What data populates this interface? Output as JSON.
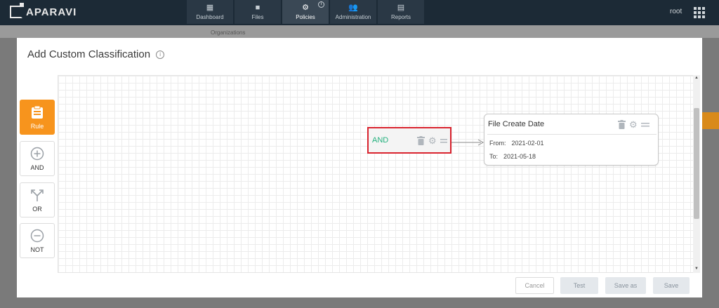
{
  "app": {
    "logo_text": "APARAVI"
  },
  "nav": {
    "items": [
      {
        "label": "Dashboard",
        "icon": "dashboard-icon"
      },
      {
        "label": "Files",
        "icon": "folder-icon"
      },
      {
        "label": "Policies",
        "icon": "gear-icon",
        "active": true
      },
      {
        "label": "Administration",
        "icon": "users-icon"
      },
      {
        "label": "Reports",
        "icon": "report-icon"
      }
    ],
    "user": "root"
  },
  "background": {
    "breadcrumb": "Organizations"
  },
  "modal": {
    "title": "Add Custom Classification",
    "tools": [
      {
        "label": "Rule",
        "icon": "clipboard-icon",
        "active": true
      },
      {
        "label": "AND",
        "icon": "plus-circle-icon"
      },
      {
        "label": "OR",
        "icon": "split-arrows-icon"
      },
      {
        "label": "NOT",
        "icon": "minus-circle-icon"
      }
    ],
    "canvas": {
      "and_node": {
        "label": "AND"
      },
      "date_node": {
        "title": "File Create Date",
        "from_label": "From:",
        "from_value": "2021-02-01",
        "to_label": "To:",
        "to_value": "2021-05-18"
      }
    },
    "buttons": {
      "cancel": "Cancel",
      "test": "Test",
      "save_as": "Save as",
      "save": "Save"
    }
  },
  "colors": {
    "nav_bg": "#1c2a36",
    "accent_orange": "#f7941d",
    "and_green": "#22b07d",
    "highlight_red": "#d9232e"
  }
}
